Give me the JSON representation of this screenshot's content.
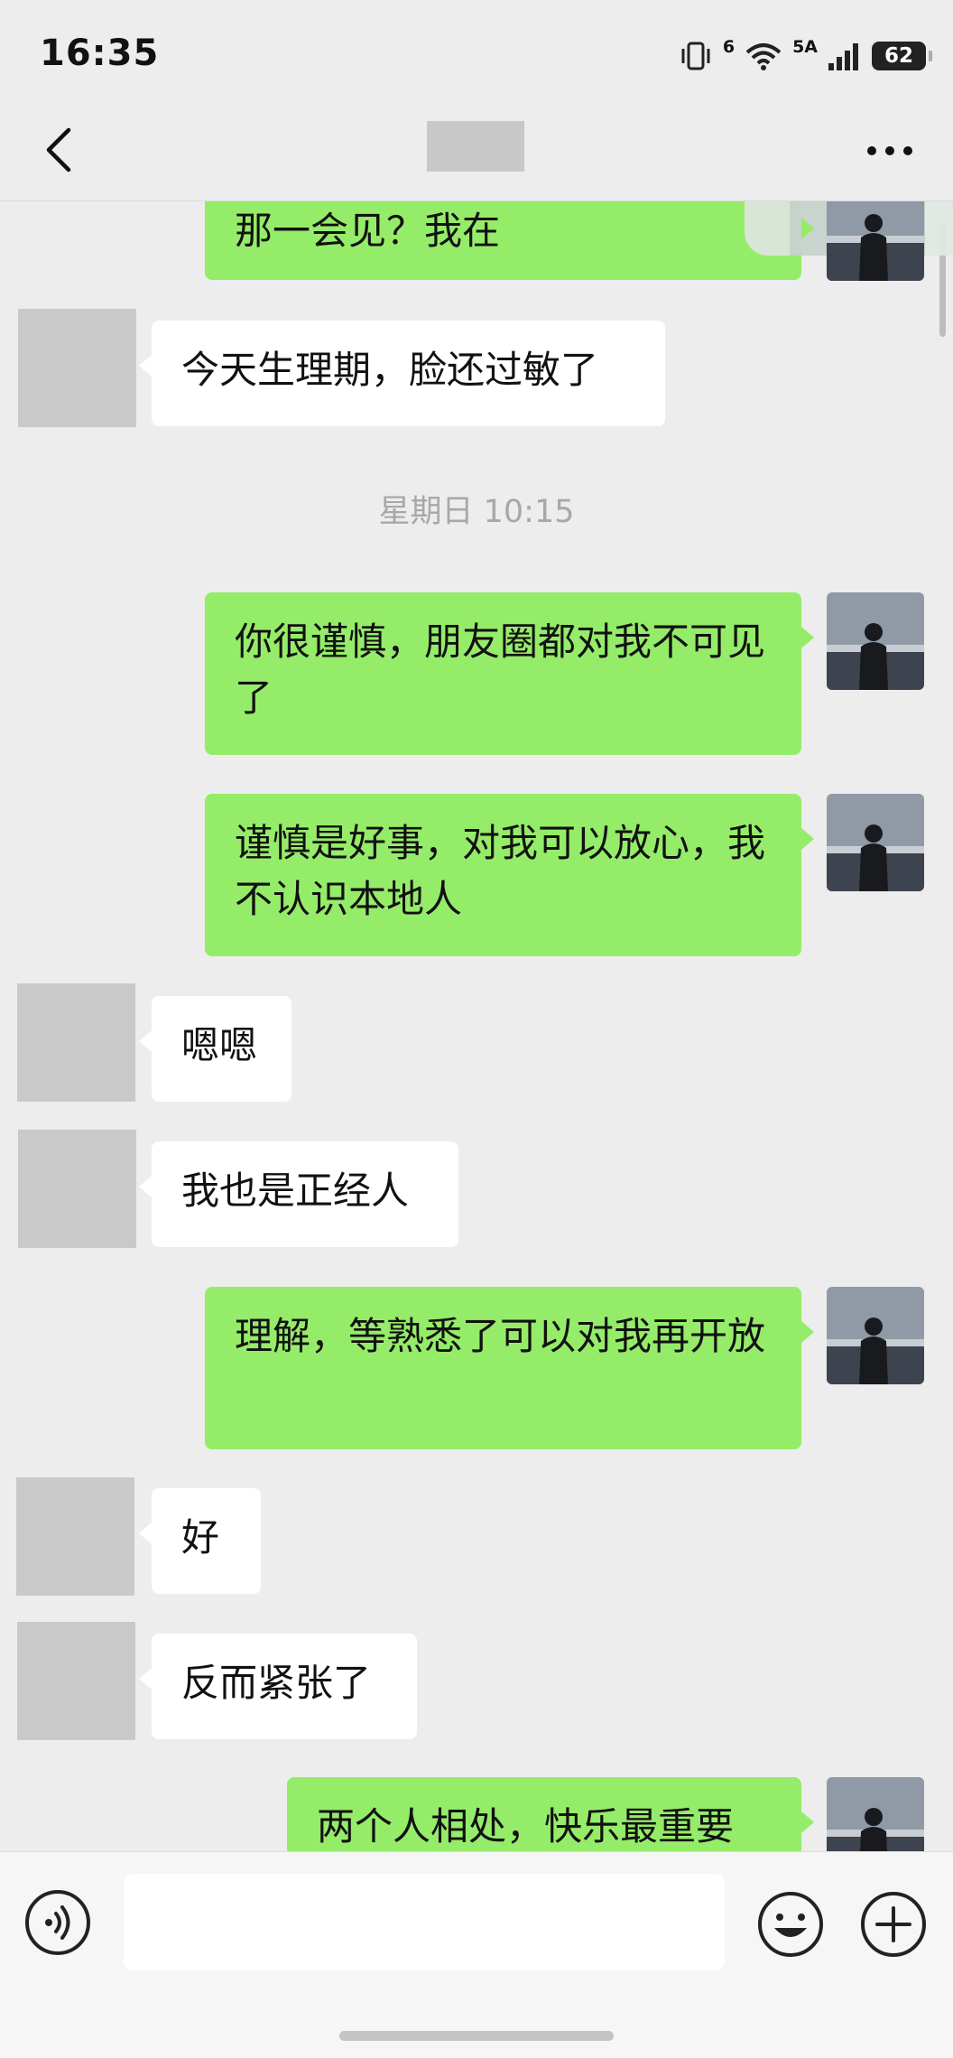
{
  "status_bar": {
    "time": "16:35",
    "wifi_label": "6",
    "signal_label": "5A",
    "battery": "62"
  },
  "nav": {
    "back_icon": "chevron-left-icon",
    "more_icon": "more-dots-icon"
  },
  "messages": [
    {
      "side": "out",
      "text": "那一会见？我在"
    },
    {
      "side": "in",
      "text": "今天生理期，脸还过敏了"
    },
    {
      "side": "out",
      "text": "你很谨慎，朋友圈都对我不可见了"
    },
    {
      "side": "out",
      "text": "谨慎是好事，对我可以放心，我不认识本地人"
    },
    {
      "side": "in",
      "text": "嗯嗯"
    },
    {
      "side": "in",
      "text": "我也是正经人"
    },
    {
      "side": "out",
      "text": "理解，等熟悉了可以对我再开放"
    },
    {
      "side": "in",
      "text": "好"
    },
    {
      "side": "in",
      "text": "反而紧张了"
    },
    {
      "side": "out",
      "text": "两个人相处，快乐最重要"
    }
  ],
  "timestamp": "星期日 10:15",
  "input_bar": {
    "voice_icon": "voice-icon",
    "input_value": "",
    "emoji_icon": "emoji-icon",
    "plus_icon": "plus-icon"
  },
  "colors": {
    "background": "#ededed",
    "outgoing_bubble": "#95ec69",
    "incoming_bubble": "#ffffff"
  }
}
